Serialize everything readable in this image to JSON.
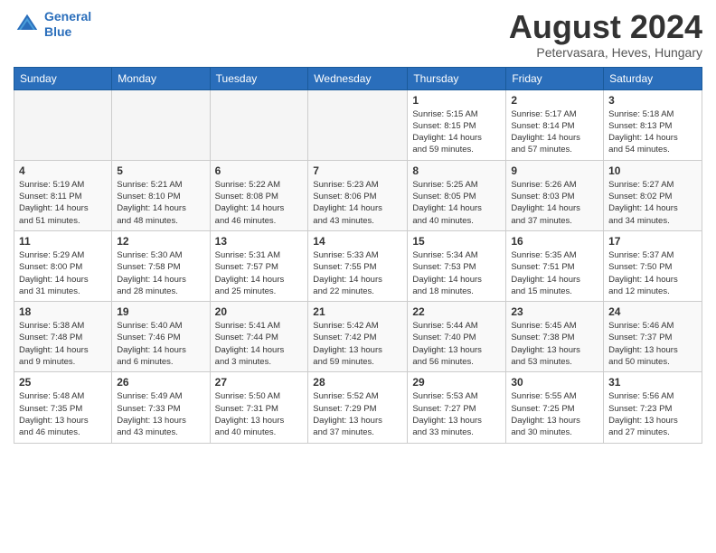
{
  "header": {
    "logo_line1": "General",
    "logo_line2": "Blue",
    "month_title": "August 2024",
    "subtitle": "Petervasara, Heves, Hungary"
  },
  "weekdays": [
    "Sunday",
    "Monday",
    "Tuesday",
    "Wednesday",
    "Thursday",
    "Friday",
    "Saturday"
  ],
  "weeks": [
    [
      {
        "day": "",
        "info": ""
      },
      {
        "day": "",
        "info": ""
      },
      {
        "day": "",
        "info": ""
      },
      {
        "day": "",
        "info": ""
      },
      {
        "day": "1",
        "info": "Sunrise: 5:15 AM\nSunset: 8:15 PM\nDaylight: 14 hours\nand 59 minutes."
      },
      {
        "day": "2",
        "info": "Sunrise: 5:17 AM\nSunset: 8:14 PM\nDaylight: 14 hours\nand 57 minutes."
      },
      {
        "day": "3",
        "info": "Sunrise: 5:18 AM\nSunset: 8:13 PM\nDaylight: 14 hours\nand 54 minutes."
      }
    ],
    [
      {
        "day": "4",
        "info": "Sunrise: 5:19 AM\nSunset: 8:11 PM\nDaylight: 14 hours\nand 51 minutes."
      },
      {
        "day": "5",
        "info": "Sunrise: 5:21 AM\nSunset: 8:10 PM\nDaylight: 14 hours\nand 48 minutes."
      },
      {
        "day": "6",
        "info": "Sunrise: 5:22 AM\nSunset: 8:08 PM\nDaylight: 14 hours\nand 46 minutes."
      },
      {
        "day": "7",
        "info": "Sunrise: 5:23 AM\nSunset: 8:06 PM\nDaylight: 14 hours\nand 43 minutes."
      },
      {
        "day": "8",
        "info": "Sunrise: 5:25 AM\nSunset: 8:05 PM\nDaylight: 14 hours\nand 40 minutes."
      },
      {
        "day": "9",
        "info": "Sunrise: 5:26 AM\nSunset: 8:03 PM\nDaylight: 14 hours\nand 37 minutes."
      },
      {
        "day": "10",
        "info": "Sunrise: 5:27 AM\nSunset: 8:02 PM\nDaylight: 14 hours\nand 34 minutes."
      }
    ],
    [
      {
        "day": "11",
        "info": "Sunrise: 5:29 AM\nSunset: 8:00 PM\nDaylight: 14 hours\nand 31 minutes."
      },
      {
        "day": "12",
        "info": "Sunrise: 5:30 AM\nSunset: 7:58 PM\nDaylight: 14 hours\nand 28 minutes."
      },
      {
        "day": "13",
        "info": "Sunrise: 5:31 AM\nSunset: 7:57 PM\nDaylight: 14 hours\nand 25 minutes."
      },
      {
        "day": "14",
        "info": "Sunrise: 5:33 AM\nSunset: 7:55 PM\nDaylight: 14 hours\nand 22 minutes."
      },
      {
        "day": "15",
        "info": "Sunrise: 5:34 AM\nSunset: 7:53 PM\nDaylight: 14 hours\nand 18 minutes."
      },
      {
        "day": "16",
        "info": "Sunrise: 5:35 AM\nSunset: 7:51 PM\nDaylight: 14 hours\nand 15 minutes."
      },
      {
        "day": "17",
        "info": "Sunrise: 5:37 AM\nSunset: 7:50 PM\nDaylight: 14 hours\nand 12 minutes."
      }
    ],
    [
      {
        "day": "18",
        "info": "Sunrise: 5:38 AM\nSunset: 7:48 PM\nDaylight: 14 hours\nand 9 minutes."
      },
      {
        "day": "19",
        "info": "Sunrise: 5:40 AM\nSunset: 7:46 PM\nDaylight: 14 hours\nand 6 minutes."
      },
      {
        "day": "20",
        "info": "Sunrise: 5:41 AM\nSunset: 7:44 PM\nDaylight: 14 hours\nand 3 minutes."
      },
      {
        "day": "21",
        "info": "Sunrise: 5:42 AM\nSunset: 7:42 PM\nDaylight: 13 hours\nand 59 minutes."
      },
      {
        "day": "22",
        "info": "Sunrise: 5:44 AM\nSunset: 7:40 PM\nDaylight: 13 hours\nand 56 minutes."
      },
      {
        "day": "23",
        "info": "Sunrise: 5:45 AM\nSunset: 7:38 PM\nDaylight: 13 hours\nand 53 minutes."
      },
      {
        "day": "24",
        "info": "Sunrise: 5:46 AM\nSunset: 7:37 PM\nDaylight: 13 hours\nand 50 minutes."
      }
    ],
    [
      {
        "day": "25",
        "info": "Sunrise: 5:48 AM\nSunset: 7:35 PM\nDaylight: 13 hours\nand 46 minutes."
      },
      {
        "day": "26",
        "info": "Sunrise: 5:49 AM\nSunset: 7:33 PM\nDaylight: 13 hours\nand 43 minutes."
      },
      {
        "day": "27",
        "info": "Sunrise: 5:50 AM\nSunset: 7:31 PM\nDaylight: 13 hours\nand 40 minutes."
      },
      {
        "day": "28",
        "info": "Sunrise: 5:52 AM\nSunset: 7:29 PM\nDaylight: 13 hours\nand 37 minutes."
      },
      {
        "day": "29",
        "info": "Sunrise: 5:53 AM\nSunset: 7:27 PM\nDaylight: 13 hours\nand 33 minutes."
      },
      {
        "day": "30",
        "info": "Sunrise: 5:55 AM\nSunset: 7:25 PM\nDaylight: 13 hours\nand 30 minutes."
      },
      {
        "day": "31",
        "info": "Sunrise: 5:56 AM\nSunset: 7:23 PM\nDaylight: 13 hours\nand 27 minutes."
      }
    ]
  ]
}
